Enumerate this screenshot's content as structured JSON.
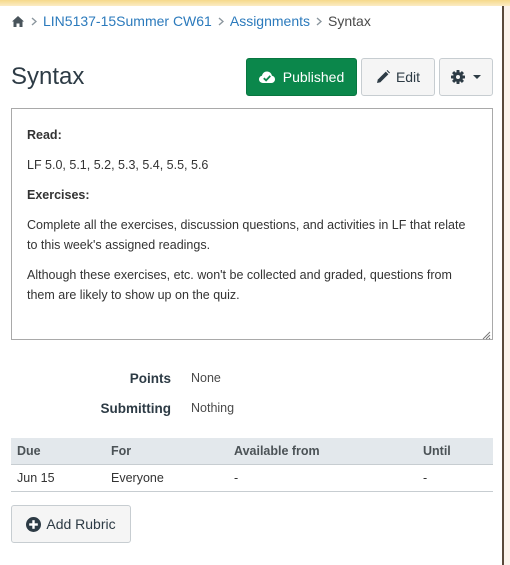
{
  "breadcrumb": {
    "home_icon": "home-icon",
    "items": [
      {
        "label": "LIN5137-15Summer CW61",
        "link": true
      },
      {
        "label": "Assignments",
        "link": true
      },
      {
        "label": "Syntax",
        "link": false
      }
    ]
  },
  "header": {
    "title": "Syntax",
    "published_label": "Published",
    "published_icon": "cloud-check-icon",
    "edit_label": "Edit",
    "edit_icon": "pencil-icon",
    "settings_icon": "gear-icon"
  },
  "description": {
    "read_label": "Read:",
    "read_text": "LF 5.0, 5.1, 5.2, 5.3, 5.4, 5.5, 5.6",
    "exercises_label": "Exercises:",
    "paragraph1": "Complete all the exercises, discussion questions, and activities in LF that relate to this week's assigned readings.",
    "paragraph2": "Although these exercises, etc. won't be collected and graded, questions from them are likely to show up on the quiz."
  },
  "details": [
    {
      "label": "Points",
      "value": "None"
    },
    {
      "label": "Submitting",
      "value": "Nothing"
    }
  ],
  "dates_table": {
    "headers": [
      "Due",
      "For",
      "Available from",
      "Until"
    ],
    "rows": [
      [
        "Jun 15",
        "Everyone",
        "-",
        "-"
      ]
    ]
  },
  "rubric": {
    "label": "Add Rubric",
    "icon": "plus-circle-icon"
  },
  "colors": {
    "published_bg": "#0b874b",
    "link": "#2b7abc",
    "table_header_bg": "#e3e8ec"
  }
}
